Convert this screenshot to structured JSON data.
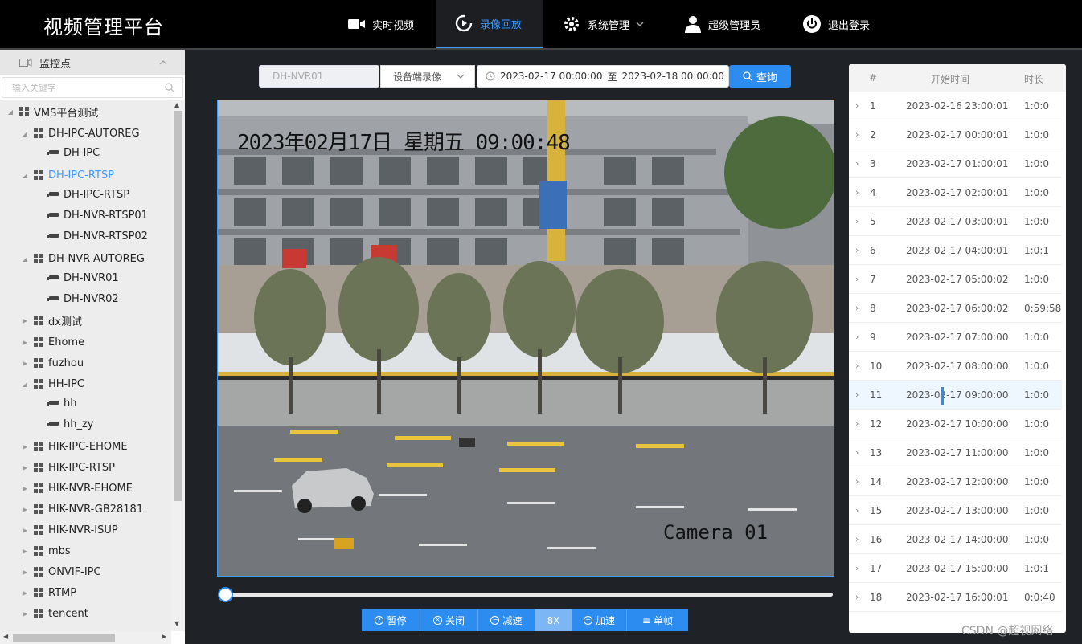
{
  "app": {
    "title": "视频管理平台"
  },
  "nav": {
    "items": [
      {
        "label": "实时视频"
      },
      {
        "label": "录像回放"
      },
      {
        "label": "系统管理"
      },
      {
        "label": "超级管理员"
      },
      {
        "label": "退出登录"
      }
    ]
  },
  "sidebar": {
    "header": "监控点",
    "search_placeholder": "输入关键字",
    "tree": [
      {
        "label": "VMS平台测试"
      },
      {
        "label": "DH-IPC-AUTOREG"
      },
      {
        "label": "DH-IPC"
      },
      {
        "label": "DH-IPC-RTSP"
      },
      {
        "label": "DH-IPC-RTSP"
      },
      {
        "label": "DH-NVR-RTSP01"
      },
      {
        "label": "DH-NVR-RTSP02"
      },
      {
        "label": "DH-NVR-AUTOREG"
      },
      {
        "label": "DH-NVR01"
      },
      {
        "label": "DH-NVR02"
      },
      {
        "label": "dx测试"
      },
      {
        "label": "Ehome"
      },
      {
        "label": "fuzhou"
      },
      {
        "label": "HH-IPC"
      },
      {
        "label": "hh"
      },
      {
        "label": "hh_zy"
      },
      {
        "label": "HIK-IPC-EHOME"
      },
      {
        "label": "HIK-IPC-RTSP"
      },
      {
        "label": "HIK-NVR-EHOME"
      },
      {
        "label": "HIK-NVR-GB28181"
      },
      {
        "label": "HIK-NVR-ISUP"
      },
      {
        "label": "mbs"
      },
      {
        "label": "ONVIF-IPC"
      },
      {
        "label": "RTMP"
      },
      {
        "label": "tencent"
      }
    ]
  },
  "filter": {
    "device": "DH-NVR01",
    "record_type": "设备端录像",
    "start": "2023-02-17 00:00:00",
    "sep": "至",
    "end": "2023-02-18 00:00:00",
    "query_label": "查询"
  },
  "video": {
    "osd_time": "2023年02月17日 星期五 09:00:48",
    "osd_camera": "Camera 01"
  },
  "playback": {
    "progress": 0.0
  },
  "controls": {
    "pause": "暂停",
    "close": "关闭",
    "slow": "减速",
    "speed": "8X",
    "fast": "加速",
    "frame": "单帧"
  },
  "records": {
    "columns": [
      "#",
      "开始时间",
      "时长"
    ],
    "rows": [
      {
        "n": "1",
        "start": "2023-02-16 23:00:01",
        "dur": "1:0:0"
      },
      {
        "n": "2",
        "start": "2023-02-17 00:00:01",
        "dur": "1:0:0"
      },
      {
        "n": "3",
        "start": "2023-02-17 01:00:01",
        "dur": "1:0:0"
      },
      {
        "n": "4",
        "start": "2023-02-17 02:00:01",
        "dur": "1:0:0"
      },
      {
        "n": "5",
        "start": "2023-02-17 03:00:01",
        "dur": "1:0:0"
      },
      {
        "n": "6",
        "start": "2023-02-17 04:00:01",
        "dur": "1:0:1"
      },
      {
        "n": "7",
        "start": "2023-02-17 05:00:02",
        "dur": "1:0:0"
      },
      {
        "n": "8",
        "start": "2023-02-17 06:00:02",
        "dur": "0:59:58"
      },
      {
        "n": "9",
        "start": "2023-02-17 07:00:00",
        "dur": "1:0:0"
      },
      {
        "n": "10",
        "start": "2023-02-17 08:00:00",
        "dur": "1:0:0"
      },
      {
        "n": "11",
        "start": "2023-02-17 09:00:00",
        "dur": "1:0:0"
      },
      {
        "n": "12",
        "start": "2023-02-17 10:00:00",
        "dur": "1:0:0"
      },
      {
        "n": "13",
        "start": "2023-02-17 11:00:00",
        "dur": "1:0:0"
      },
      {
        "n": "14",
        "start": "2023-02-17 12:00:00",
        "dur": "1:0:0"
      },
      {
        "n": "15",
        "start": "2023-02-17 13:00:00",
        "dur": "1:0:0"
      },
      {
        "n": "16",
        "start": "2023-02-17 14:00:00",
        "dur": "1:0:0"
      },
      {
        "n": "17",
        "start": "2023-02-17 15:00:00",
        "dur": "1:0:1"
      },
      {
        "n": "18",
        "start": "2023-02-17 16:00:01",
        "dur": "0:0:40"
      }
    ]
  },
  "watermark": "CSDN @超视网络",
  "colors": {
    "accent": "#2d8cf0",
    "topbar": "#000000",
    "selected": "#3d9bff"
  }
}
